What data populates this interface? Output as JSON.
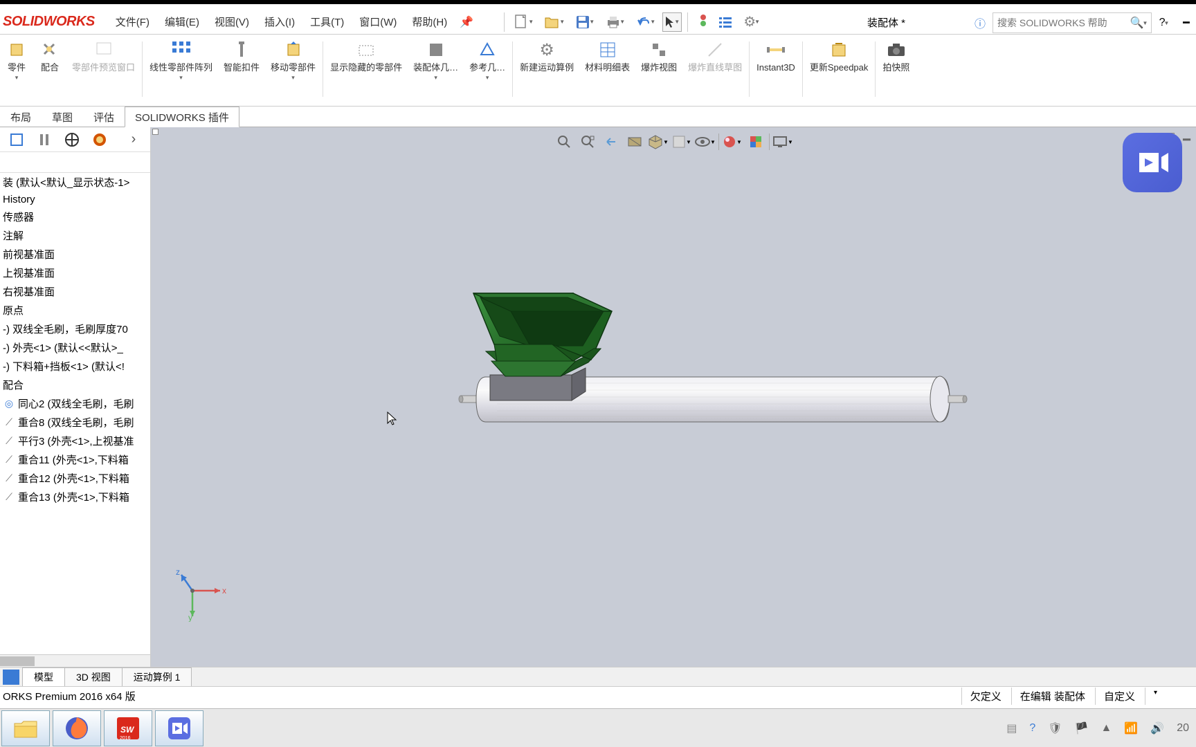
{
  "app_name": "SOLIDWORKS",
  "document_title": "装配体 *",
  "menu": {
    "file": "文件(F)",
    "edit": "编辑(E)",
    "view": "视图(V)",
    "insert": "插入(I)",
    "tools": "工具(T)",
    "window": "窗口(W)",
    "help": "帮助(H)"
  },
  "search_placeholder": "搜索 SOLIDWORKS 帮助",
  "ribbon": {
    "part": "零件",
    "mate": "配合",
    "preview": "零部件预览窗口",
    "linear_pattern": "线性零部件阵列",
    "smart_fastener": "智能扣件",
    "move_component": "移动零部件",
    "show_hidden": "显示隐藏的零部件",
    "assembly_feature": "装配体几…",
    "ref_geom": "参考几…",
    "new_motion": "新建运动算例",
    "bom": "材料明细表",
    "exploded_view": "爆炸视图",
    "explode_line": "爆炸直线草图",
    "instant3d": "Instant3D",
    "update_speedpak": "更新Speedpak",
    "snapshot": "拍快照"
  },
  "tabs": {
    "layout": "布局",
    "sketch": "草图",
    "evaluate": "评估",
    "plugins": "SOLIDWORKS 插件"
  },
  "tree": {
    "root": "装 (默认<默认_显示状态-1>",
    "history": "History",
    "sensors": "传感器",
    "annotations": "注解",
    "front_plane": "前视基准面",
    "top_plane": "上视基准面",
    "right_plane": "右视基准面",
    "origin": "原点",
    "part1": "-) 双线全毛刷，毛刷厚度70",
    "part2": "-) 外壳<1> (默认<<默认>_",
    "part3": "-) 下料箱+挡板<1> (默认<!",
    "mates": "配合",
    "mate1": "同心2 (双线全毛刷，毛刷",
    "mate2": "重合8 (双线全毛刷，毛刷",
    "mate3": "平行3 (外壳<1>,上视基准",
    "mate4": "重合11 (外壳<1>,下料箱",
    "mate5": "重合12 (外壳<1>,下料箱",
    "mate6": "重合13 (外壳<1>,下料箱"
  },
  "triad": {
    "x": "x",
    "y": "y",
    "z": "z"
  },
  "bottom_tabs": {
    "model": "模型",
    "view3d": "3D 视图",
    "motion1": "运动算例 1"
  },
  "status": {
    "version": "ORKS Premium 2016 x64 版",
    "underdef": "欠定义",
    "editing": "在编辑 装配体",
    "custom": "自定义"
  },
  "clock": "20"
}
